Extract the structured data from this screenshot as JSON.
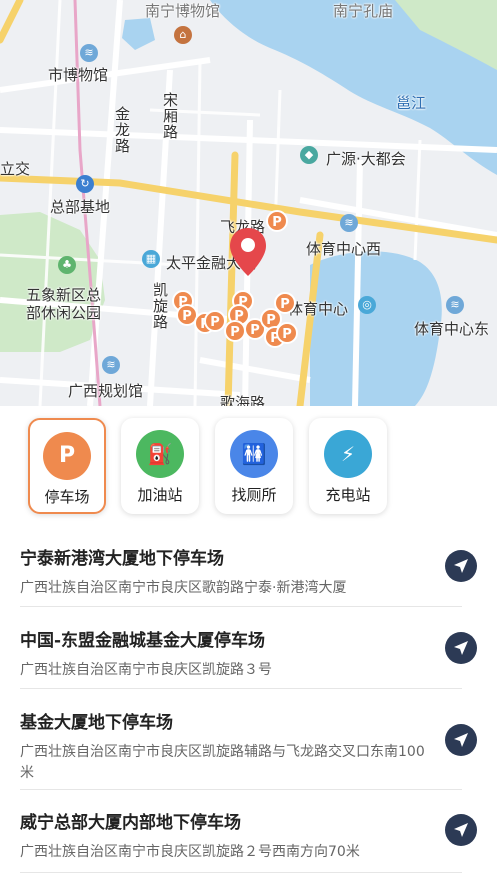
{
  "map": {
    "labels": {
      "city_museum": "市博物馆",
      "jinlong_road": "金龙路",
      "songpu_road": "宋厢路",
      "liyi": "立交",
      "hq_base": "总部基地",
      "feilong_road": "飞龙路",
      "taiping_finance": "太平金融大厦",
      "kaixuan_road": "凯旋路",
      "sports_center": "体育中心",
      "sports_center_west": "体育中心西",
      "sports_center_east": "体育中心东",
      "guangyuan": "广源·大都会",
      "yong_river": "邕江",
      "wuxiang_park": "五象新区总部休闲公园",
      "gx_planning": "广西规划馆",
      "geyun_road": "歌海路",
      "top_left_cut": "南宁博物馆",
      "top_right_cut": "南宁孔庙"
    }
  },
  "categories": [
    {
      "label": "停车场",
      "icon": "parking-icon",
      "glyph": "P",
      "color": "#ef8a4e",
      "active": true
    },
    {
      "label": "加油站",
      "icon": "gas-station-icon",
      "glyph": "⛽",
      "color": "#4cb860",
      "active": false
    },
    {
      "label": "找厕所",
      "icon": "restroom-icon",
      "glyph": "🚻",
      "color": "#4a86e8",
      "active": false
    },
    {
      "label": "充电站",
      "icon": "charging-station-icon",
      "glyph": "⚡",
      "color": "#3aa7d6",
      "active": false
    }
  ],
  "results": [
    {
      "title": "宁泰新港湾大厦地下停车场",
      "address": "广西壮族自治区南宁市良庆区歌韵路宁泰·新港湾大厦"
    },
    {
      "title": "中国-东盟金融城基金大厦停车场",
      "address": "广西壮族自治区南宁市良庆区凯旋路３号"
    },
    {
      "title": "基金大厦地下停车场",
      "address": "广西壮族自治区南宁市良庆区凯旋路辅路与飞龙路交叉口东南100米"
    },
    {
      "title": "威宁总部大厦内部地下停车场",
      "address": "广西壮族自治区南宁市良庆区凯旋路２号西南方向70米"
    }
  ],
  "colors": {
    "accent": "#ef8a4e",
    "nav_button": "#2c3a55",
    "water": "#a9d3f0",
    "road_yellow": "#f6d26b",
    "park": "#cfe9c8"
  }
}
